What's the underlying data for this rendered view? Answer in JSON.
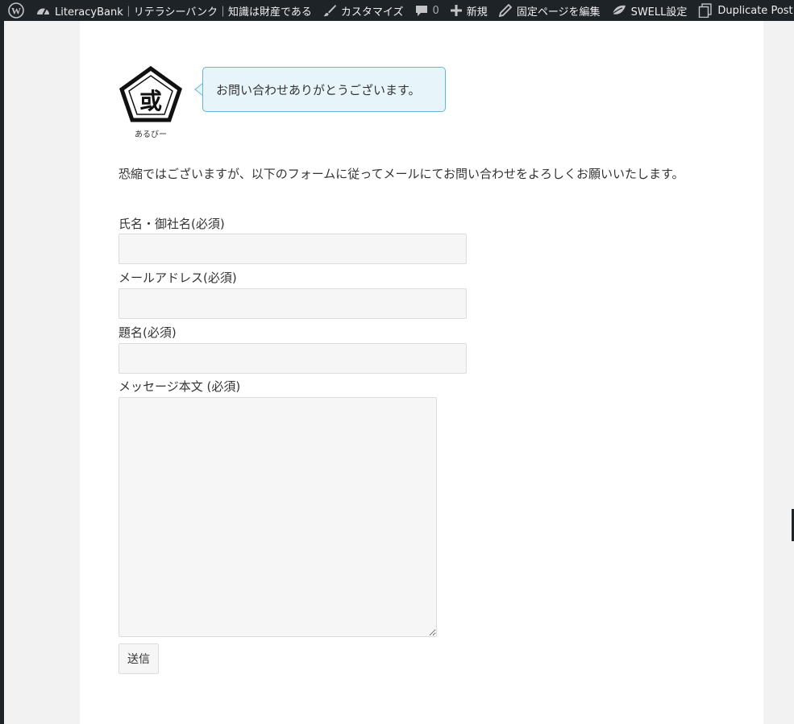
{
  "admin_bar": {
    "site_name": "LiteracyBank｜リテラシーバンク｜知識は財産である",
    "customize": "カスタマイズ",
    "comments_count": "0",
    "new": "新規",
    "edit_page": "固定ページを編集",
    "swell_settings": "SWELL設定",
    "duplicate_post": "Duplicate Post"
  },
  "balloon": {
    "avatar_name": "あるびー",
    "avatar_glyph": "或",
    "message": "お問い合わせありがとうございます。"
  },
  "intro_text": "恐縮ではございますが、以下のフォームに従ってメールにてお問い合わせをよろしくお願いいたします。",
  "form": {
    "name_label": "氏名・御社名(必須)",
    "email_label": "メールアドレス(必須)",
    "subject_label": "題名(必須)",
    "message_label": "メッセージ本文 (必須)",
    "submit_label": "送信"
  },
  "icons": {
    "wp": "wordpress-icon",
    "site": "dashboard-icon",
    "customize": "paintbrush-icon",
    "comments": "comment-bubble-icon",
    "new": "plus-icon",
    "edit": "pencil-icon",
    "swell": "swell-leaf-icon",
    "duplicate": "duplicate-icon"
  },
  "colors": {
    "admin_bar_bg": "#1d2327",
    "bubble_bg": "#e7f5fb",
    "bubble_border": "#5fb9d2"
  }
}
